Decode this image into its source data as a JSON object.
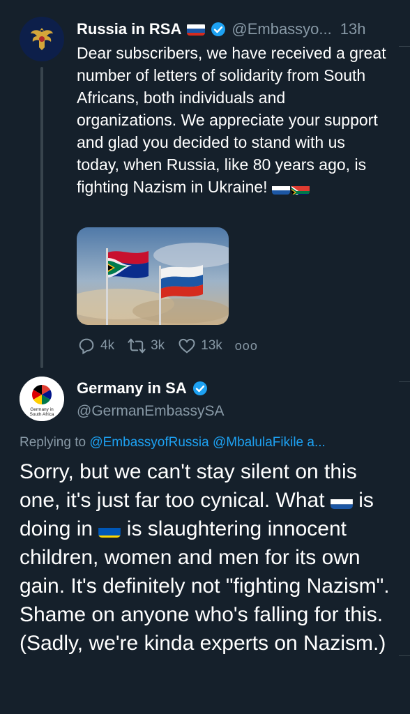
{
  "tweet1": {
    "display_name": "Russia in RSA",
    "handle": "@Embassyo...",
    "time": "13h",
    "body": "Dear subscribers, we have received a great number of letters of solidarity from South Africans, both individuals and organizations. We appreciate your support and glad you decided to stand with us today, when Russia, like 80 years ago, is fighting Nazism in Ukraine!",
    "reply_count": "4k",
    "retweet_count": "3k",
    "like_count": "13k",
    "more_label": "ooo"
  },
  "tweet2": {
    "display_name": "Germany in SA",
    "handle": "@GermanEmbassySA",
    "avatar_text_line1": "Germany in",
    "avatar_text_line2": "South Africa",
    "replying_prefix": "Replying to",
    "replying_mentions": "@EmbassyofRussia @MbalulaFikile a...",
    "body_part1": "Sorry, but we can't stay silent on this one, it's just far too cynical. What",
    "body_part2": "is doing in",
    "body_part3": "is slaughtering innocent children, women and men for its own gain. It's definitely not \"fighting Nazism\". Shame on anyone who's falling for this. (Sadly, we're kinda experts on Nazism.)"
  },
  "colors": {
    "background": "#15202b",
    "secondary_text": "#8899a6",
    "link": "#1da1f2",
    "verified": "#1da1f2"
  }
}
